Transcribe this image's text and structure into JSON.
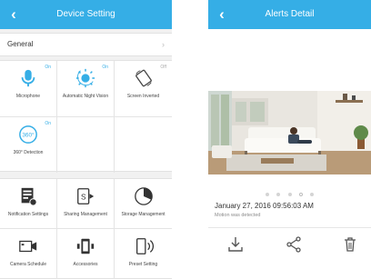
{
  "device_setting": {
    "title": "Device Setting",
    "general_label": "General",
    "group1": [
      {
        "label": "Microphone",
        "status": "On"
      },
      {
        "label": "Automatic Night Vision",
        "status": "On"
      },
      {
        "label": "Screen Inverted",
        "status": "Off"
      },
      {
        "label": "360° Detection",
        "status": "On",
        "icon_text": "360°"
      }
    ],
    "group2": [
      {
        "label": "Notification Settings"
      },
      {
        "label": "Sharing Management",
        "icon_text": "S"
      },
      {
        "label": "Storage Management"
      },
      {
        "label": "Camera Schedule"
      },
      {
        "label": "Accessories"
      },
      {
        "label": "Preset Setting"
      }
    ]
  },
  "alerts_detail": {
    "title": "Alerts Detail",
    "date": "January 27, 2016  09:56:03 AM",
    "message": "Motion was detected"
  },
  "colors": {
    "accent": "#35aee6",
    "icon": "#333333"
  },
  "icons": {
    "back": "chevron-left-icon",
    "download": "download-icon",
    "share": "share-icon",
    "delete": "trash-icon"
  }
}
